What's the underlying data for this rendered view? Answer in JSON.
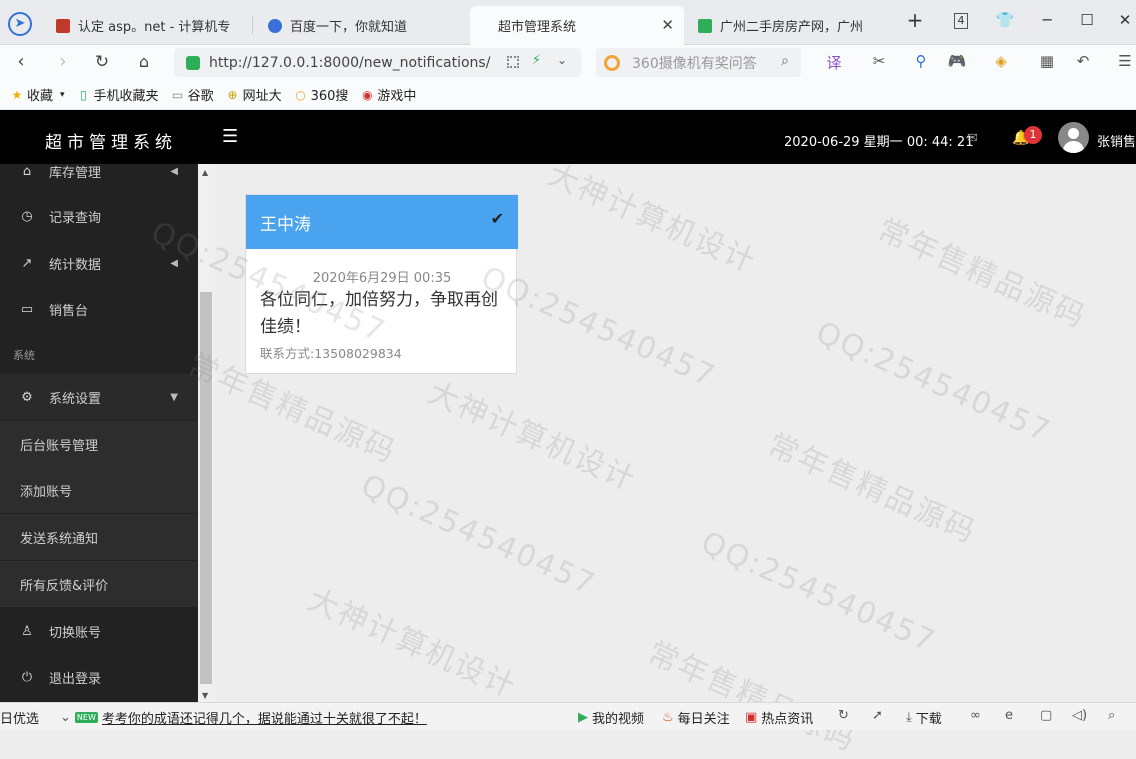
{
  "browser": {
    "tabs": [
      {
        "title": "认定 asp。net - 计算机专",
        "favicon_color": "#c0392b"
      },
      {
        "title": "百度一下，你就知道",
        "favicon_color": "#3a6fd8"
      },
      {
        "title": "超市管理系统",
        "active": true
      },
      {
        "title": "广州二手房房产网，广州二",
        "favicon_color": "#2fae5a"
      }
    ],
    "tab_count": "4",
    "url": "http://127.0.0.1:8000/new_notifications/",
    "search_placeholder": "360摄像机有奖问答",
    "bookmarks": [
      "收藏",
      "手机收藏夹",
      "谷歌",
      "网址大",
      "360搜",
      "游戏中"
    ]
  },
  "header": {
    "title": "超市管理系统",
    "datetime": "2020-06-29 星期一 00: 44: 21",
    "notification_count": "1",
    "username": "张销售"
  },
  "sidebar": {
    "items": [
      {
        "label": "库存管理",
        "icon": "home-icon"
      },
      {
        "label": "记录查询",
        "icon": "clock-icon"
      },
      {
        "label": "统计数据",
        "icon": "chart-icon"
      },
      {
        "label": "销售台",
        "icon": "monitor-icon"
      }
    ],
    "section_label": "系统",
    "settings_label": "系统设置",
    "sub_items": [
      "后台账号管理",
      "添加账号",
      "发送系统通知",
      "所有反馈&评价"
    ],
    "switch_label": "切换账号",
    "logout_label": "退出登录"
  },
  "notification": {
    "sender": "王中涛",
    "date": "2020年6月29日 00:35",
    "message": "各位同仁，加倍努力，争取再创佳绩！",
    "contact": "联系方式:13508029834"
  },
  "watermarks": [
    "常年售精品源码",
    "QQ:254540457",
    "大神计算机设计"
  ],
  "statusbar": {
    "left": "日优选",
    "news": "考考你的成语还记得几个，据说能通过十关就很了不起！",
    "new_tag": "NEW",
    "items": [
      "我的视频",
      "每日关注",
      "热点资讯",
      "下载"
    ]
  }
}
